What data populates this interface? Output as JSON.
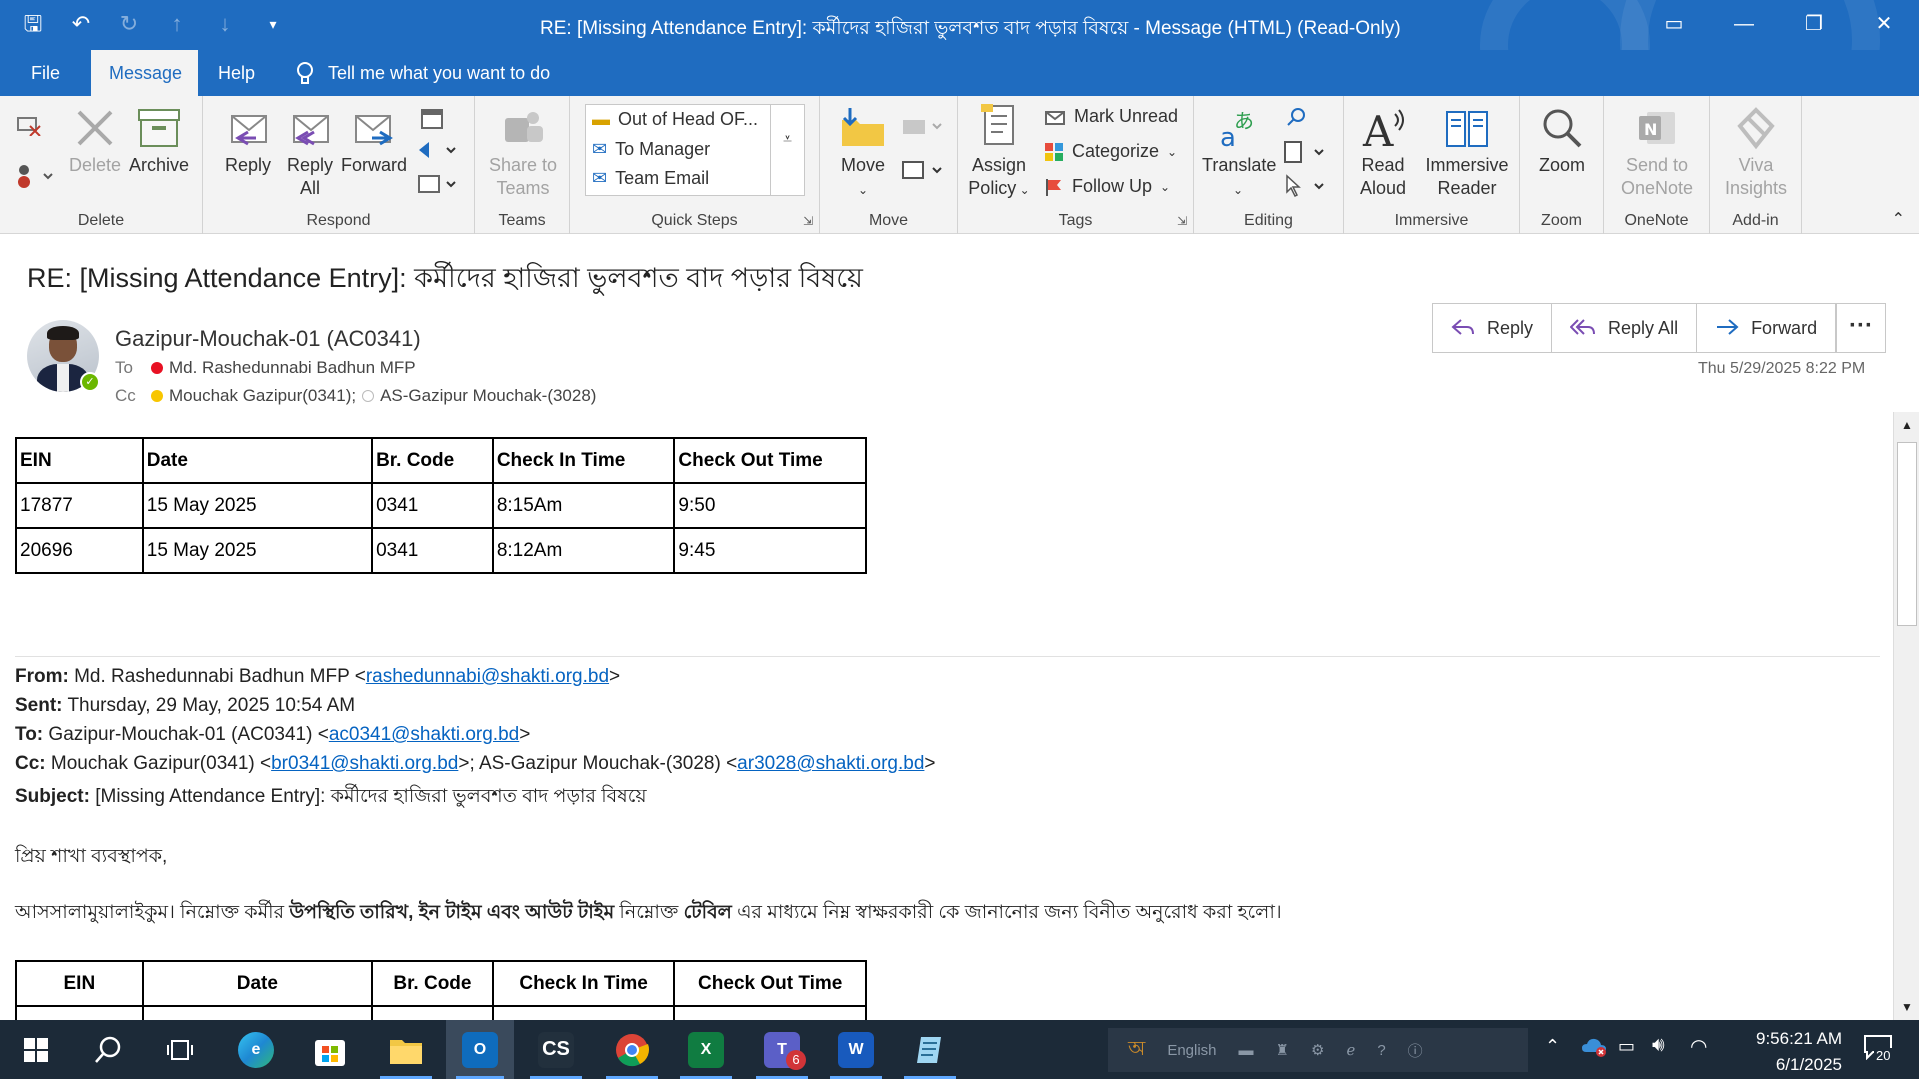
{
  "window": {
    "title": "RE: [Missing Attendance Entry]: কর্মীদের হাজিরা ভুলবশত বাদ পড়ার বিষয়ে  -  Message (HTML) (Read-Only)"
  },
  "menu": {
    "tabs": [
      "File",
      "Message",
      "Help"
    ],
    "active_tab": "Message",
    "tell_me": "Tell me what you want to do"
  },
  "ribbon": {
    "delete_group": {
      "label": "Delete",
      "delete": "Delete",
      "archive": "Archive"
    },
    "respond_group": {
      "label": "Respond",
      "reply": "Reply",
      "reply_all_1": "Reply",
      "reply_all_2": "All",
      "forward": "Forward"
    },
    "teams_group": {
      "label": "Teams",
      "share_1": "Share to",
      "share_2": "Teams"
    },
    "quick_steps": {
      "label": "Quick Steps",
      "items": [
        "Out of Head OF...",
        "To Manager",
        "Team Email"
      ]
    },
    "move_group": {
      "label": "Move",
      "move": "Move"
    },
    "tags_group": {
      "label": "Tags",
      "assign_1": "Assign",
      "assign_2": "Policy",
      "mark_unread": "Mark Unread",
      "categorize": "Categorize",
      "follow_up": "Follow Up"
    },
    "editing_group": {
      "label": "Editing",
      "translate": "Translate"
    },
    "immersive_group": {
      "label": "Immersive",
      "read_1": "Read",
      "read_2": "Aloud",
      "reader_1": "Immersive",
      "reader_2": "Reader"
    },
    "zoom_group": {
      "label": "Zoom",
      "zoom": "Zoom"
    },
    "onenote_group": {
      "label": "OneNote",
      "send_1": "Send to",
      "send_2": "OneNote"
    },
    "addin_group": {
      "label": "Add-in",
      "viva_1": "Viva",
      "viva_2": "Insights"
    }
  },
  "message": {
    "subject": "RE: [Missing Attendance Entry]: কর্মীদের হাজিরা ভুলবশত বাদ পড়ার বিষয়ে",
    "sender": "Gazipur-Mouchak-01 (AC0341)",
    "to_label": "To",
    "to": "Md. Rashedunnabi Badhun MFP",
    "cc_label": "Cc",
    "cc_1": "Mouchak Gazipur(0341);",
    "cc_2": "AS-Gazipur Mouchak-(3028)",
    "timestamp": "Thu 5/29/2025 8:22 PM",
    "actions": {
      "reply": "Reply",
      "reply_all": "Reply All",
      "forward": "Forward",
      "more": "···"
    }
  },
  "table1": {
    "headers": [
      "EIN",
      "Date",
      "Br. Code",
      "Check In Time",
      "Check Out Time"
    ],
    "rows": [
      [
        "17877",
        "15 May 2025",
        "0341",
        "8:15Am",
        "9:50"
      ],
      [
        "20696",
        "15 May 2025",
        "0341",
        "8:12Am",
        "9:45"
      ]
    ]
  },
  "forwarded": {
    "from_label": "From:",
    "from_name": "Md. Rashedunnabi Badhun MFP <",
    "from_email": "rashedunnabi@shakti.org.bd",
    "sent_label": "Sent:",
    "sent": "Thursday, 29 May, 2025 10:54 AM",
    "to_label": "To:",
    "to_name": "Gazipur-Mouchak-01 (AC0341) <",
    "to_email": "ac0341@shakti.org.bd",
    "cc_label": "Cc:",
    "cc_name1": "Mouchak Gazipur(0341) <",
    "cc_email1": "br0341@shakti.org.bd",
    "cc_name2": ">; AS-Gazipur Mouchak-(3028) <",
    "cc_email2": "ar3028@shakti.org.bd",
    "subject_label": "Subject:",
    "subject": "[Missing Attendance Entry]: কর্মীদের  হাজিরা  ভুলবশত  বাদ  পড়ার  বিষয়ে",
    "greeting": "প্রিয়  শাখা  ব্যবস্থাপক,",
    "para_1": "আসসালামুয়ালাইকুম। নিম্নোক্ত  কর্মীর  ",
    "para_bold_1": "উপস্থিতি তারিখ, ইন টাইম এবং আউট টাইম",
    "para_2": " নিম্নোক্ত ",
    "para_bold_2": "টেবিল",
    "para_3": " এর  মাধ্যমে  নিম্ন  স্বাক্ষরকারী  কে  জানানোর  জন্য  বিনীত  অনুরোধ  করা  হলো।"
  },
  "table2": {
    "headers": [
      "EIN",
      "Date",
      "Br. Code",
      "Check In Time",
      "Check Out Time"
    ]
  },
  "taskbar": {
    "lang": "English",
    "time": "9:56:21 AM",
    "date": "6/1/2025",
    "notifications": "20",
    "teams_badge": "6"
  },
  "colors": {
    "titlebar": "#1f6cc0",
    "ribbon": "#f3f3f3",
    "taskbar": "#1c2a38",
    "link": "#0563c1"
  }
}
